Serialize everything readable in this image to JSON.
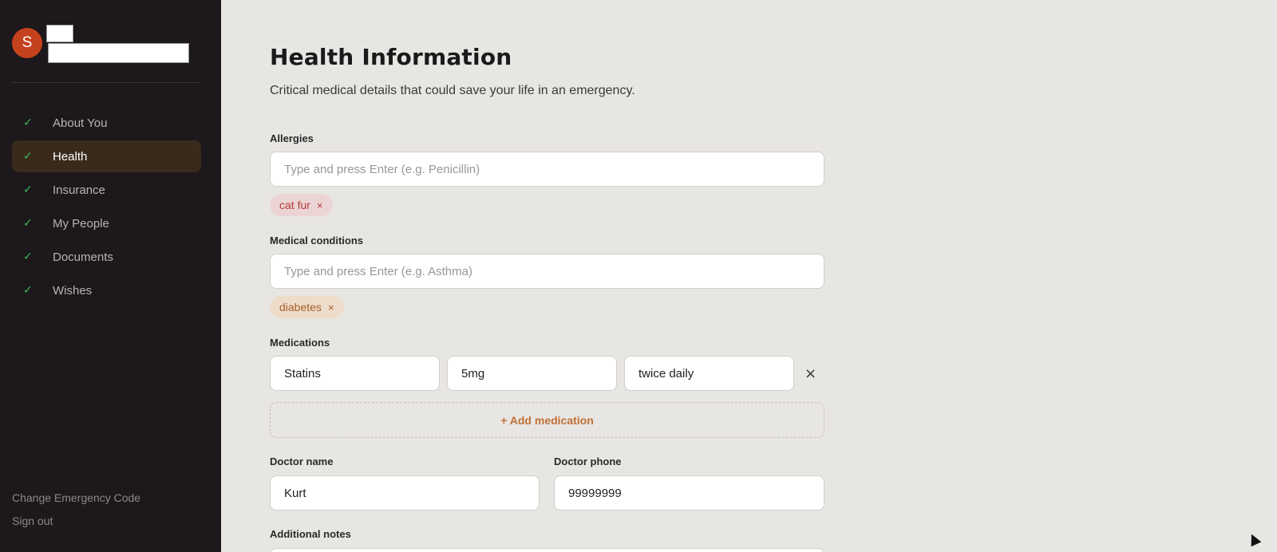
{
  "sidebar": {
    "avatar_letter": "S",
    "nav": [
      {
        "label": "About You",
        "check": "✓"
      },
      {
        "label": "Health",
        "check": "✓"
      },
      {
        "label": "Insurance",
        "check": "✓"
      },
      {
        "label": "My People",
        "check": "✓"
      },
      {
        "label": "Documents",
        "check": "✓"
      },
      {
        "label": "Wishes",
        "check": "✓"
      }
    ],
    "change_code": "Change Emergency Code",
    "sign_out": "Sign out"
  },
  "page": {
    "title": "Health Information",
    "subtitle": "Critical medical details that could save your life in an emergency."
  },
  "allergies": {
    "label": "Allergies",
    "placeholder": "Type and press Enter (e.g. Penicillin)",
    "chips": [
      "cat fur"
    ]
  },
  "conditions": {
    "label": "Medical conditions",
    "placeholder": "Type and press Enter (e.g. Asthma)",
    "chips": [
      "diabetes"
    ]
  },
  "medications": {
    "label": "Medications",
    "rows": [
      {
        "name": "Statins",
        "dose": "5mg",
        "frequency": "twice daily"
      }
    ],
    "add_label": "+ Add medication"
  },
  "doctor": {
    "name_label": "Doctor name",
    "name_value": "Kurt",
    "phone_label": "Doctor phone",
    "phone_value": "99999999"
  },
  "notes": {
    "label": "Additional notes"
  },
  "glyphs": {
    "close": "×"
  },
  "colors": {
    "accent": "#c07035",
    "sidebar_bg": "#1c181b",
    "check": "#3bbd5c"
  }
}
